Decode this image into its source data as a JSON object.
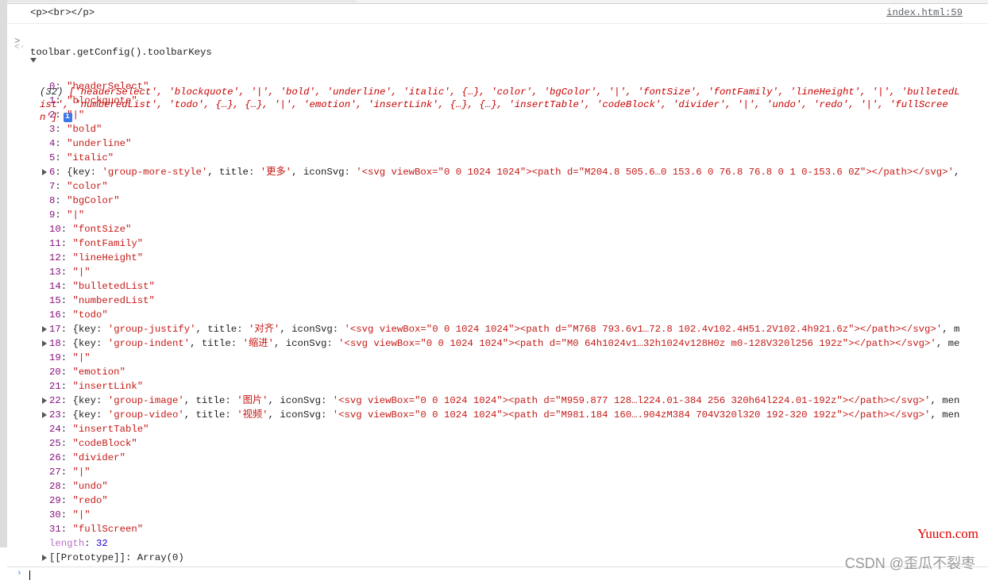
{
  "log": {
    "text": "<p><br></p>",
    "source": "index.html:59"
  },
  "command": "toolbar.getConfig().toolbarKeys",
  "result_summary": {
    "count": "(32)",
    "preview": "['headerSelect', 'blockquote', '|', 'bold', 'underline', 'italic', {…}, 'color', 'bgColor', '|', 'fontSize', 'fontFamily', 'lineHeight', '|', 'bulletedList', 'numberedList', 'todo', {…}, {…}, '|', 'emotion', 'insertLink', {…}, {…}, 'insertTable', 'codeBlock', 'divider', '|', 'undo', 'redo', '|', 'fullScreen']",
    "info_badge": "i"
  },
  "entries": [
    {
      "index": "0",
      "value": "\"headerSelect\""
    },
    {
      "index": "1",
      "value": "\"blockquote\""
    },
    {
      "index": "2",
      "value": "\"|\""
    },
    {
      "index": "3",
      "value": "\"bold\""
    },
    {
      "index": "4",
      "value": "\"underline\""
    },
    {
      "index": "5",
      "value": "\"italic\""
    },
    {
      "index": "6",
      "key": "'group-more-style'",
      "title": "'更多'",
      "iconSvg": "'<svg viewBox=\"0 0 1024 1024\"><path d=\"M204.8 505.6…0 153.6 0 76.8 76.8 0 1 0-153.6 0Z\"></path></svg>'",
      "tail": ","
    },
    {
      "index": "7",
      "value": "\"color\""
    },
    {
      "index": "8",
      "value": "\"bgColor\""
    },
    {
      "index": "9",
      "value": "\"|\""
    },
    {
      "index": "10",
      "value": "\"fontSize\""
    },
    {
      "index": "11",
      "value": "\"fontFamily\""
    },
    {
      "index": "12",
      "value": "\"lineHeight\""
    },
    {
      "index": "13",
      "value": "\"|\""
    },
    {
      "index": "14",
      "value": "\"bulletedList\""
    },
    {
      "index": "15",
      "value": "\"numberedList\""
    },
    {
      "index": "16",
      "value": "\"todo\""
    },
    {
      "index": "17",
      "key": "'group-justify'",
      "title": "'对齐'",
      "iconSvg": "'<svg viewBox=\"0 0 1024 1024\"><path d=\"M768 793.6v1…72.8 102.4v102.4H51.2V102.4h921.6z\"></path></svg>'",
      "tail": ", m"
    },
    {
      "index": "18",
      "key": "'group-indent'",
      "title": "'缩进'",
      "iconSvg": "'<svg viewBox=\"0 0 1024 1024\"><path d=\"M0 64h1024v1…32h1024v128H0z m0-128V320l256 192z\"></path></svg>'",
      "tail": ", me"
    },
    {
      "index": "19",
      "value": "\"|\""
    },
    {
      "index": "20",
      "value": "\"emotion\""
    },
    {
      "index": "21",
      "value": "\"insertLink\""
    },
    {
      "index": "22",
      "key": "'group-image'",
      "title": "'图片'",
      "iconSvg": "'<svg viewBox=\"0 0 1024 1024\"><path d=\"M959.877 128…l224.01-384 256 320h64l224.01-192z\"></path></svg>'",
      "tail": ", men"
    },
    {
      "index": "23",
      "key": "'group-video'",
      "title": "'视频'",
      "iconSvg": "'<svg viewBox=\"0 0 1024 1024\"><path d=\"M981.184 160….904zM384 704V320l320 192-320 192z\"></path></svg>'",
      "tail": ", men"
    },
    {
      "index": "24",
      "value": "\"insertTable\""
    },
    {
      "index": "25",
      "value": "\"codeBlock\""
    },
    {
      "index": "26",
      "value": "\"divider\""
    },
    {
      "index": "27",
      "value": "\"|\""
    },
    {
      "index": "28",
      "value": "\"undo\""
    },
    {
      "index": "29",
      "value": "\"redo\""
    },
    {
      "index": "30",
      "value": "\"|\""
    },
    {
      "index": "31",
      "value": "\"fullScreen\""
    }
  ],
  "length": {
    "label": "length",
    "value": "32"
  },
  "prototype": {
    "label": "[[Prototype]]",
    "value": "Array(0)"
  },
  "watermarks": {
    "site": "Yuucn.com",
    "csdn": "CSDN @歪瓜不裂枣"
  }
}
